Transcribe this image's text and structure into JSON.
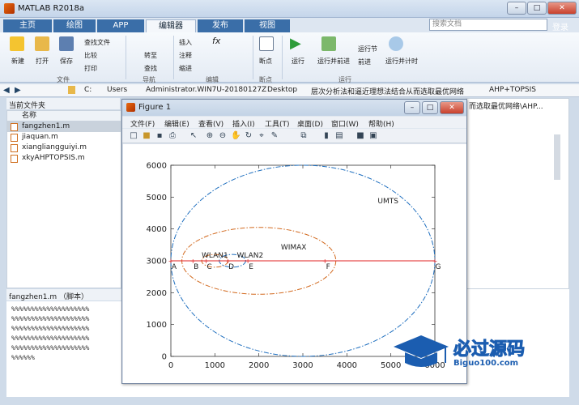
{
  "window": {
    "title": "MATLAB R2018a",
    "search_placeholder": "搜索文档",
    "login": "登录"
  },
  "tabs": [
    "主页",
    "绘图",
    "APP",
    "编辑器",
    "发布",
    "视图"
  ],
  "ribbon": {
    "file": {
      "new": "新建",
      "open": "打开",
      "save": "保存",
      "find_files": "查找文件",
      "compare": "比较",
      "print": "打印",
      "group": "文件"
    },
    "nav": {
      "goto": "转至",
      "find": "查找",
      "group": "导航"
    },
    "edit": {
      "insert": "插入",
      "comment": "注释",
      "indent": "缩进",
      "group": "编辑"
    },
    "breakpoints": {
      "label": "断点",
      "group": "断点"
    },
    "run": {
      "run": "运行",
      "run_advance": "运行并前进",
      "run_section": "运行节",
      "advance": "前进",
      "run_time": "运行并计时",
      "group": "运行"
    }
  },
  "address": {
    "segments": [
      "C:",
      "Users",
      "Administrator.WIN7U-20180127Z",
      "Desktop",
      "层次分析法和逼近理想法结合从而选取最优网络",
      "AHP+TOPSIS"
    ]
  },
  "current_folder": {
    "title": "当前文件夹",
    "column": "名称",
    "files": [
      "fangzhen1.m",
      "jiaquan.m",
      "xiangliangguiyi.m",
      "xkyAHPTOPSIS.m"
    ]
  },
  "details": {
    "label": "fangzhen1.m （脚本）"
  },
  "code_lines": [
    "%%%%%%%%%%%%%%%%%%%%",
    "%%%%%%%%%%%%%%%%%%%%",
    "%%%%%%%%%%%%%%%%%%%%",
    "%%%%%%%%%%%%%%%%%%%%",
    "%%%%%%%%%%%%%%%%%%%%",
    "%%%%%%"
  ],
  "right_path": "而选取最优网络\\AHP...",
  "figure": {
    "title": "Figure 1",
    "menu": [
      "文件(F)",
      "编辑(E)",
      "查看(V)",
      "插入(I)",
      "工具(T)",
      "桌面(D)",
      "窗口(W)",
      "帮助(H)"
    ]
  },
  "chart_data": {
    "type": "line",
    "xlim": [
      0,
      6000
    ],
    "ylim": [
      0,
      6000
    ],
    "x_ticks": [
      0,
      1000,
      2000,
      3000,
      4000,
      5000,
      6000
    ],
    "y_ticks": [
      0,
      1000,
      2000,
      3000,
      4000,
      5000,
      6000
    ],
    "ellipses": [
      {
        "name": "UMTS",
        "cx": 3000,
        "cy": 3000,
        "rx": 3000,
        "ry": 3000,
        "color": "#1f6fbf",
        "dash": "dashdot"
      },
      {
        "name": "WIMAX",
        "cx": 2000,
        "cy": 3000,
        "rx": 1750,
        "ry": 1050,
        "color": "#d2691e",
        "dash": "dashdot"
      },
      {
        "name": "WLAN1",
        "cx": 1000,
        "cy": 3000,
        "rx": 300,
        "ry": 200,
        "color": "#d2691e",
        "dash": "dashdot"
      },
      {
        "name": "WLAN2",
        "cx": 1400,
        "cy": 3000,
        "rx": 300,
        "ry": 200,
        "color": "#1f6fbf",
        "dash": "dashdot"
      }
    ],
    "path": {
      "y": 3000,
      "color": "#e02020"
    },
    "points": [
      {
        "label": "A",
        "x": 0
      },
      {
        "label": "B",
        "x": 500
      },
      {
        "label": "C",
        "x": 800
      },
      {
        "label": "D",
        "x": 1300
      },
      {
        "label": "E",
        "x": 1750
      },
      {
        "label": "F",
        "x": 3500
      },
      {
        "label": "G",
        "x": 6000
      }
    ],
    "annotations": [
      {
        "text": "UMTS",
        "x": 4700,
        "y": 4800
      },
      {
        "text": "WIMAX",
        "x": 2500,
        "y": 3350
      },
      {
        "text": "WLAN1",
        "x": 700,
        "y": 3100
      },
      {
        "text": "WLAN2",
        "x": 1500,
        "y": 3100
      }
    ]
  },
  "watermark": {
    "text": "必过源码",
    "url": "Biguo100.com"
  }
}
